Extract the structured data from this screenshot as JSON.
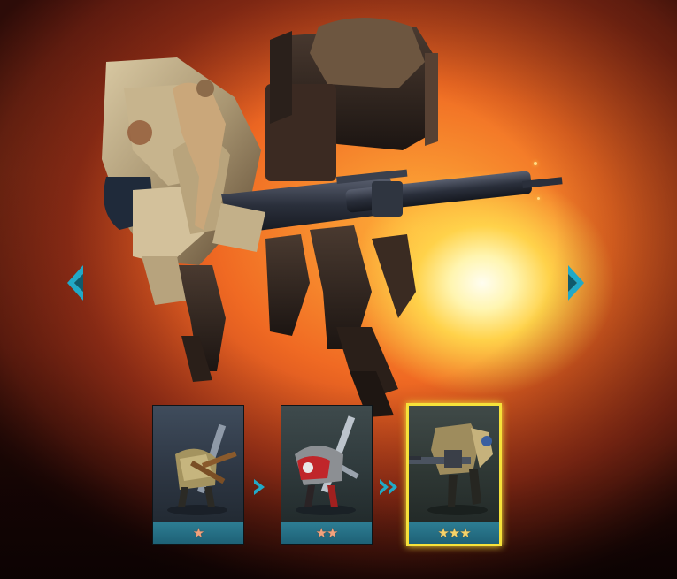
{
  "carousel": {
    "prev_icon": "chevron-left-icon",
    "next_icon": "chevron-right-icon",
    "accent_color": "#21a9c7"
  },
  "tiers": [
    {
      "name": "tier-1",
      "stars": "★",
      "star_count": 1,
      "selected": false
    },
    {
      "name": "tier-2",
      "stars": "★★",
      "star_count": 2,
      "selected": false
    },
    {
      "name": "tier-3",
      "stars": "★★★",
      "star_count": 3,
      "selected": true
    }
  ],
  "colors": {
    "star": "#f1a27d",
    "selected_border": "#f6e23a",
    "card_footer": "#2d7d93"
  }
}
